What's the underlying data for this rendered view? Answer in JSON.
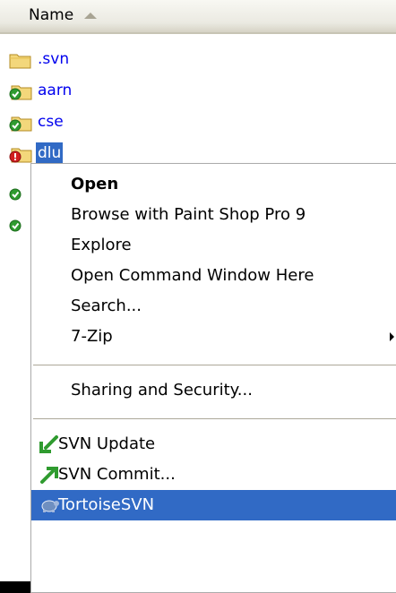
{
  "column_header": {
    "name_label": "Name"
  },
  "files": [
    {
      "name": ".svn",
      "icon": "plain-folder-icon"
    },
    {
      "name": "aarn",
      "icon": "svn-normal-folder-icon"
    },
    {
      "name": "cse",
      "icon": "svn-normal-folder-icon"
    },
    {
      "name": "dlu",
      "icon": "svn-modified-folder-icon",
      "selected": true
    }
  ],
  "context_menu": {
    "items": [
      {
        "label": "Open"
      },
      {
        "label": "Browse with Paint Shop Pro 9"
      },
      {
        "label": "Explore"
      },
      {
        "label": "Open Command Window Here"
      },
      {
        "label": "Search..."
      },
      {
        "label": "7-Zip"
      },
      {
        "label": "Sharing and Security..."
      },
      {
        "label": "SVN Update"
      },
      {
        "label": "SVN Commit..."
      },
      {
        "label": "TortoiseSVN"
      }
    ]
  },
  "colors": {
    "selection": "#316ac5",
    "link_text": "#0000ee",
    "svn_green": "#2f9b2f",
    "svn_red": "#d21f1f"
  }
}
